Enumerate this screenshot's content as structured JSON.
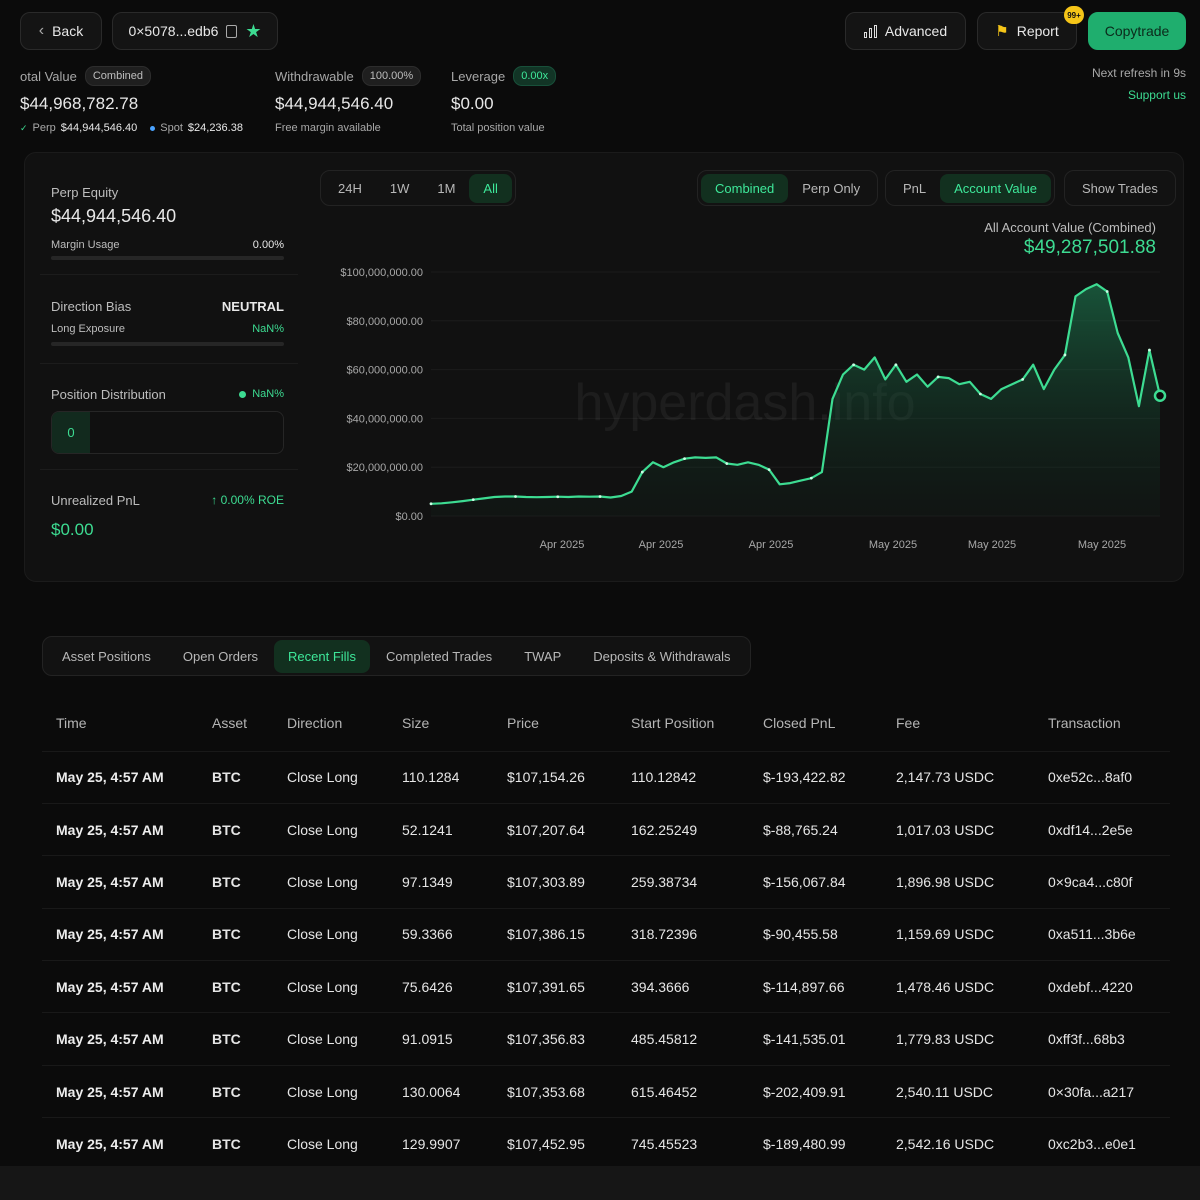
{
  "header": {
    "back_label": "Back",
    "address": "0×5078...edb6",
    "advanced_label": "Advanced",
    "report_label": "Report",
    "report_badge": "99+",
    "copytrade_label": "Copytrade"
  },
  "summary": {
    "total_label": "otal Value",
    "total_pill": "Combined",
    "total_value": "$44,968,782.78",
    "perp_label": "Perp",
    "perp_value": "$44,944,546.40",
    "spot_label": "Spot",
    "spot_value": "$24,236.38",
    "withdrawable_label": "Withdrawable",
    "withdrawable_pill": "100.00%",
    "withdrawable_value": "$44,944,546.40",
    "withdrawable_sub": "Free margin available",
    "leverage_label": "Leverage",
    "leverage_pill": "0.00x",
    "leverage_value": "$0.00",
    "leverage_sub": "Total position value",
    "refresh_label": "Next refresh in 9s",
    "support_label": "Support us"
  },
  "left_panel": {
    "perp_equity_label": "Perp Equity",
    "perp_equity_value": "$44,944,546.40",
    "margin_usage_label": "Margin Usage",
    "margin_usage_value": "0.00%",
    "direction_bias_label": "Direction Bias",
    "direction_bias_value": "NEUTRAL",
    "long_exposure_label": "Long Exposure",
    "long_exposure_value": "NaN%",
    "position_dist_label": "Position Distribution",
    "position_dist_value": "NaN%",
    "position_dist_count": "0",
    "upnl_label": "Unrealized PnL",
    "upnl_roe": "0.00% ROE",
    "upnl_value": "$0.00"
  },
  "chart_controls": {
    "ranges": [
      "24H",
      "1W",
      "1M",
      "All"
    ],
    "active_range": "All",
    "modes": [
      "Combined",
      "Perp Only"
    ],
    "active_mode": "Combined",
    "metrics": [
      "PnL",
      "Account Value"
    ],
    "active_metric": "Account Value",
    "show_trades_label": "Show Trades",
    "value_title": "All Account Value (Combined)",
    "value": "$49,287,501.88",
    "watermark": "hyperdash.info"
  },
  "chart_data": {
    "type": "area",
    "title": "All Account Value (Combined)",
    "y_ticks": [
      "$100,000,000.00",
      "$80,000,000.00",
      "$60,000,000.00",
      "$40,000,000.00",
      "$20,000,000.00",
      "$0.00"
    ],
    "x_ticks": [
      "Apr 2025",
      "Apr 2025",
      "Apr 2025",
      "May 2025",
      "May 2025",
      "May 2025"
    ],
    "ylim": [
      0,
      100000000
    ],
    "y": [
      5000000,
      5200000,
      5600000,
      6100000,
      6700000,
      7200000,
      7800000,
      8000000,
      8000000,
      7800000,
      7700000,
      7800000,
      7900000,
      7800000,
      8000000,
      7900000,
      8000000,
      7600000,
      8200000,
      10000000,
      18000000,
      22000000,
      20000000,
      22000000,
      23500000,
      24000000,
      23800000,
      24000000,
      21500000,
      21000000,
      22000000,
      21000000,
      19000000,
      13000000,
      13500000,
      14500000,
      15500000,
      18000000,
      48000000,
      58000000,
      62000000,
      60000000,
      65000000,
      56000000,
      62000000,
      55000000,
      58000000,
      53000000,
      57000000,
      56500000,
      54000000,
      55000000,
      50000000,
      48000000,
      52000000,
      54000000,
      56000000,
      62000000,
      52000000,
      60000000,
      66000000,
      90000000,
      93000000,
      95000000,
      92000000,
      75000000,
      65000000,
      45000000,
      68000000,
      49287501.88
    ],
    "grid": true,
    "color": "#3ddc92"
  },
  "tabs": {
    "items": [
      "Asset Positions",
      "Open Orders",
      "Recent Fills",
      "Completed Trades",
      "TWAP",
      "Deposits & Withdrawals"
    ],
    "active": "Recent Fills"
  },
  "fills": {
    "columns": [
      "Time",
      "Asset",
      "Direction",
      "Size",
      "Price",
      "Start Position",
      "Closed PnL",
      "Fee",
      "Transaction"
    ],
    "rows": [
      [
        "May 25, 4:57 AM",
        "BTC",
        "Close Long",
        "110.1284",
        "$107,154.26",
        "110.12842",
        "$-193,422.82",
        "2,147.73 USDC",
        "0xe52c...8af0"
      ],
      [
        "May 25, 4:57 AM",
        "BTC",
        "Close Long",
        "52.1241",
        "$107,207.64",
        "162.25249",
        "$-88,765.24",
        "1,017.03 USDC",
        "0xdf14...2e5e"
      ],
      [
        "May 25, 4:57 AM",
        "BTC",
        "Close Long",
        "97.1349",
        "$107,303.89",
        "259.38734",
        "$-156,067.84",
        "1,896.98 USDC",
        "0×9ca4...c80f"
      ],
      [
        "May 25, 4:57 AM",
        "BTC",
        "Close Long",
        "59.3366",
        "$107,386.15",
        "318.72396",
        "$-90,455.58",
        "1,159.69 USDC",
        "0xa511...3b6e"
      ],
      [
        "May 25, 4:57 AM",
        "BTC",
        "Close Long",
        "75.6426",
        "$107,391.65",
        "394.3666",
        "$-114,897.66",
        "1,478.46 USDC",
        "0xdebf...4220"
      ],
      [
        "May 25, 4:57 AM",
        "BTC",
        "Close Long",
        "91.0915",
        "$107,356.83",
        "485.45812",
        "$-141,535.01",
        "1,779.83 USDC",
        "0xff3f...68b3"
      ],
      [
        "May 25, 4:57 AM",
        "BTC",
        "Close Long",
        "130.0064",
        "$107,353.68",
        "615.46452",
        "$-202,409.91",
        "2,540.11 USDC",
        "0×30fa...a217"
      ],
      [
        "May 25, 4:57 AM",
        "BTC",
        "Close Long",
        "129.9907",
        "$107,452.95",
        "745.45523",
        "$-189,480.99",
        "2,542.16 USDC",
        "0xc2b3...e0e1"
      ]
    ]
  },
  "colors": {
    "accent": "#3ddc92",
    "negative": "#ef5b5b",
    "copytrade_bg": "#1fae6e"
  }
}
